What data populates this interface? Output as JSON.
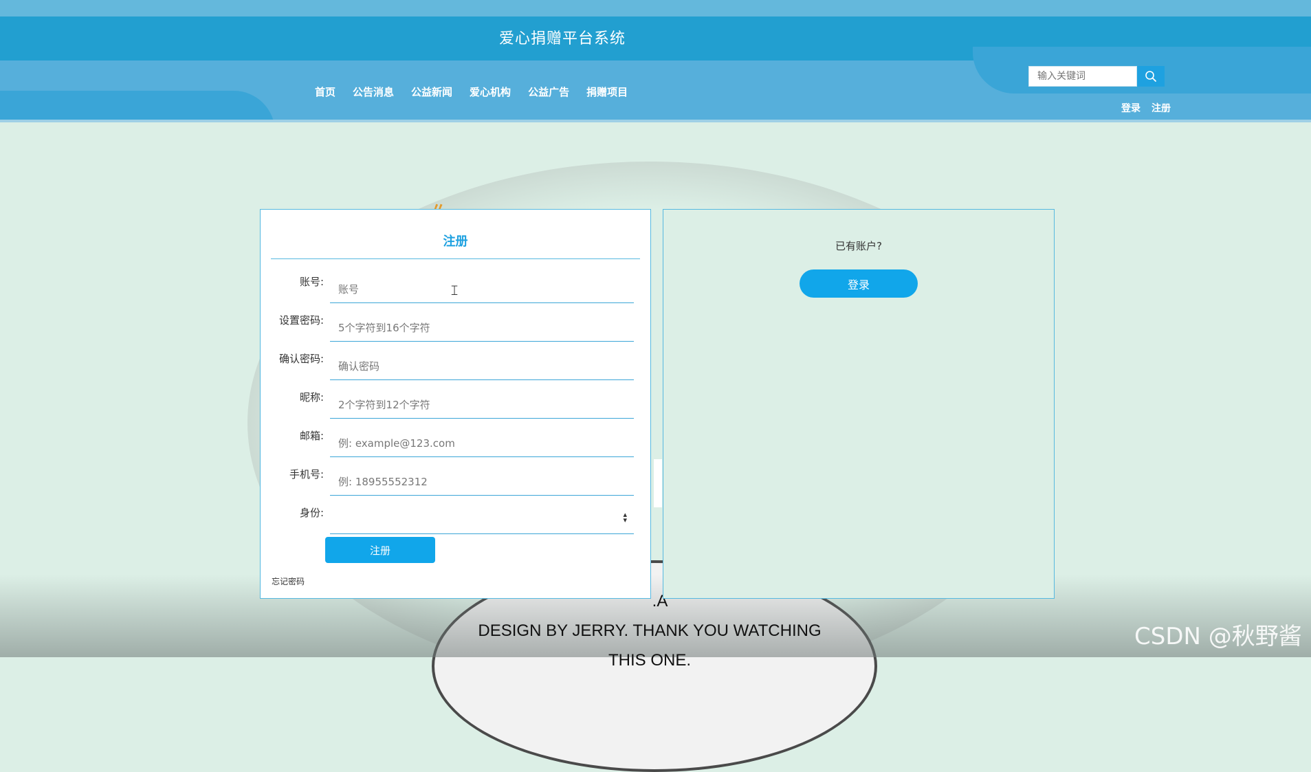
{
  "header": {
    "site_title": "爱心捐赠平台系统",
    "nav": [
      "首页",
      "公告消息",
      "公益新闻",
      "爱心机构",
      "公益广告",
      "捐赠项目"
    ],
    "search_placeholder": "输入关键词",
    "auth": {
      "login": "登录",
      "register": "注册"
    }
  },
  "register_form": {
    "title": "注册",
    "fields": [
      {
        "label": "账号:",
        "placeholder": "账号"
      },
      {
        "label": "设置密码:",
        "placeholder": "5个字符到16个字符"
      },
      {
        "label": "确认密码:",
        "placeholder": "确认密码"
      },
      {
        "label": "昵称:",
        "placeholder": "2个字符到12个字符"
      },
      {
        "label": "邮箱:",
        "placeholder": "例: example@123.com"
      },
      {
        "label": "手机号:",
        "placeholder": "例: 18955552312"
      },
      {
        "label": "身份:",
        "value": ""
      }
    ],
    "submit_label": "注册",
    "forgot_label": "忘记密码"
  },
  "login_panel": {
    "question": "已有账户?",
    "login_label": "登录"
  },
  "background": {
    "caption_line1": ".A",
    "caption_line2": "DESIGN BY JERRY. THANK YOU WATCHING",
    "caption_line3": "THIS ONE.",
    "watermark": "CSDN @秋野酱"
  },
  "colors": {
    "header_main": "#229fd0",
    "nav_bg": "#56afdb",
    "accent": "#11a6ea",
    "page_bg": "#dcefe6"
  }
}
